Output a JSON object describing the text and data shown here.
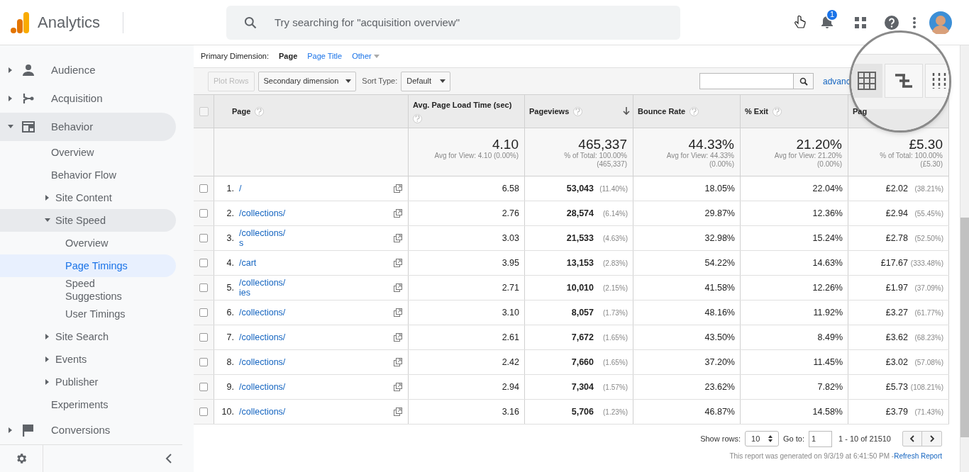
{
  "app": {
    "title": "Analytics"
  },
  "search": {
    "placeholder": "Try searching for \"acquisition overview\""
  },
  "notifications": {
    "count": "1"
  },
  "sidebar": {
    "items": [
      {
        "label": "Audience",
        "expanded": false,
        "selected": false
      },
      {
        "label": "Acquisition",
        "expanded": false,
        "selected": false
      },
      {
        "label": "Behavior",
        "expanded": true,
        "selected": false,
        "children": [
          {
            "label": "Overview",
            "selected": false
          },
          {
            "label": "Behavior Flow",
            "selected": false
          },
          {
            "label": "Site Content",
            "expanded": false,
            "selected": false
          },
          {
            "label": "Site Speed",
            "expanded": true,
            "selected": false,
            "children": [
              {
                "label": "Overview",
                "selected": false
              },
              {
                "label": "Page Timings",
                "selected": true
              },
              {
                "label": "Speed Suggestions",
                "selected": false
              },
              {
                "label": "User Timings",
                "selected": false
              }
            ]
          },
          {
            "label": "Site Search",
            "expanded": false,
            "selected": false
          },
          {
            "label": "Events",
            "expanded": false,
            "selected": false
          },
          {
            "label": "Publisher",
            "expanded": false,
            "selected": false
          },
          {
            "label": "Experiments",
            "selected": false
          }
        ]
      },
      {
        "label": "Conversions",
        "expanded": false,
        "selected": false
      }
    ]
  },
  "primary_dimension": {
    "label": "Primary Dimension:",
    "options": [
      {
        "label": "Page",
        "selected": true
      },
      {
        "label": "Page Title",
        "selected": false
      },
      {
        "label": "Other",
        "selected": false
      }
    ]
  },
  "toolbar": {
    "plot_rows": "Plot Rows",
    "secondary_dimension": "Secondary dimension",
    "sort_type_label": "Sort Type:",
    "sort_type": "Default",
    "advanced": "advanc"
  },
  "table": {
    "select_all": {
      "checked": false
    },
    "columns": [
      {
        "label": "Page",
        "help": true,
        "sorted": false
      },
      {
        "label": "Avg. Page Load Time (sec)",
        "help": true,
        "sorted": false
      },
      {
        "label": "Pageviews",
        "help": true,
        "sorted": true
      },
      {
        "label": "Bounce Rate",
        "help": true,
        "sorted": false
      },
      {
        "label": "% Exit",
        "help": true,
        "sorted": false
      },
      {
        "label": "Pag",
        "help": false,
        "sorted": false
      }
    ],
    "summary": [
      {
        "value": "4.10",
        "note": [
          "Avg for View: 4.10 (0.00%)"
        ]
      },
      {
        "value": "465,337",
        "note": [
          "% of Total: 100.00%",
          "(465,337)"
        ]
      },
      {
        "value": "44.33%",
        "note": [
          "Avg for View: 44.33%",
          "(0.00%)"
        ]
      },
      {
        "value": "21.20%",
        "note": [
          "Avg for View: 21.20%",
          "(0.00%)"
        ]
      },
      {
        "value": "£5.30",
        "note": [
          "% of Total: 100.00%",
          "(£5.30)"
        ]
      }
    ],
    "rows": [
      {
        "checked": false,
        "index": "1.",
        "page": [
          "/"
        ],
        "load": "6.58",
        "pageviews": "53,043",
        "pageviews_pct": "(11.40%)",
        "bounce": "18.05%",
        "exit": "22.04%",
        "value": "£2.02",
        "value_pct": "(38.21%)"
      },
      {
        "checked": false,
        "index": "2.",
        "page": [
          "/collections/"
        ],
        "load": "2.76",
        "pageviews": "28,574",
        "pageviews_pct": "(6.14%)",
        "bounce": "29.87%",
        "exit": "12.36%",
        "value": "£2.94",
        "value_pct": "(55.45%)"
      },
      {
        "checked": false,
        "index": "3.",
        "page": [
          "/collections/",
          "s"
        ],
        "load": "3.03",
        "pageviews": "21,533",
        "pageviews_pct": "(4.63%)",
        "bounce": "32.98%",
        "exit": "15.24%",
        "value": "£2.78",
        "value_pct": "(52.50%)"
      },
      {
        "checked": false,
        "index": "4.",
        "page": [
          "/cart"
        ],
        "load": "3.95",
        "pageviews": "13,153",
        "pageviews_pct": "(2.83%)",
        "bounce": "54.22%",
        "exit": "14.63%",
        "value": "£17.67",
        "value_pct": "(333.48%)"
      },
      {
        "checked": false,
        "index": "5.",
        "page": [
          "/collections/",
          "ies"
        ],
        "load": "2.71",
        "pageviews": "10,010",
        "pageviews_pct": "(2.15%)",
        "bounce": "41.58%",
        "exit": "12.26%",
        "value": "£1.97",
        "value_pct": "(37.09%)"
      },
      {
        "checked": false,
        "index": "6.",
        "page": [
          "/collections/"
        ],
        "load": "3.10",
        "pageviews": "8,057",
        "pageviews_pct": "(1.73%)",
        "bounce": "48.16%",
        "exit": "11.92%",
        "value": "£3.27",
        "value_pct": "(61.77%)"
      },
      {
        "checked": false,
        "index": "7.",
        "page": [
          "/collections/"
        ],
        "load": "2.61",
        "pageviews": "7,672",
        "pageviews_pct": "(1.65%)",
        "bounce": "43.50%",
        "exit": "8.49%",
        "value": "£3.62",
        "value_pct": "(68.23%)"
      },
      {
        "checked": false,
        "index": "8.",
        "page": [
          "/collections/"
        ],
        "load": "2.42",
        "pageviews": "7,660",
        "pageviews_pct": "(1.65%)",
        "bounce": "37.20%",
        "exit": "11.45%",
        "value": "£3.02",
        "value_pct": "(57.08%)"
      },
      {
        "checked": false,
        "index": "9.",
        "page": [
          "/collections/"
        ],
        "load": "2.94",
        "pageviews": "7,304",
        "pageviews_pct": "(1.57%)",
        "bounce": "23.62%",
        "exit": "7.82%",
        "value": "£5.73",
        "value_pct": "(108.21%)"
      },
      {
        "checked": false,
        "index": "10.",
        "page": [
          "/collections/"
        ],
        "load": "3.16",
        "pageviews": "5,706",
        "pageviews_pct": "(1.23%)",
        "bounce": "46.87%",
        "exit": "14.58%",
        "value": "£3.79",
        "value_pct": "(71.43%)"
      }
    ]
  },
  "pagination": {
    "show_rows_label": "Show rows:",
    "show_rows": "10",
    "go_to_label": "Go to:",
    "go_to": "1",
    "range": "1 - 10 of 21510"
  },
  "footer": {
    "note": "This report was generated on 9/3/19 at 6:41:50 PM - ",
    "refresh": "Refresh Report"
  }
}
